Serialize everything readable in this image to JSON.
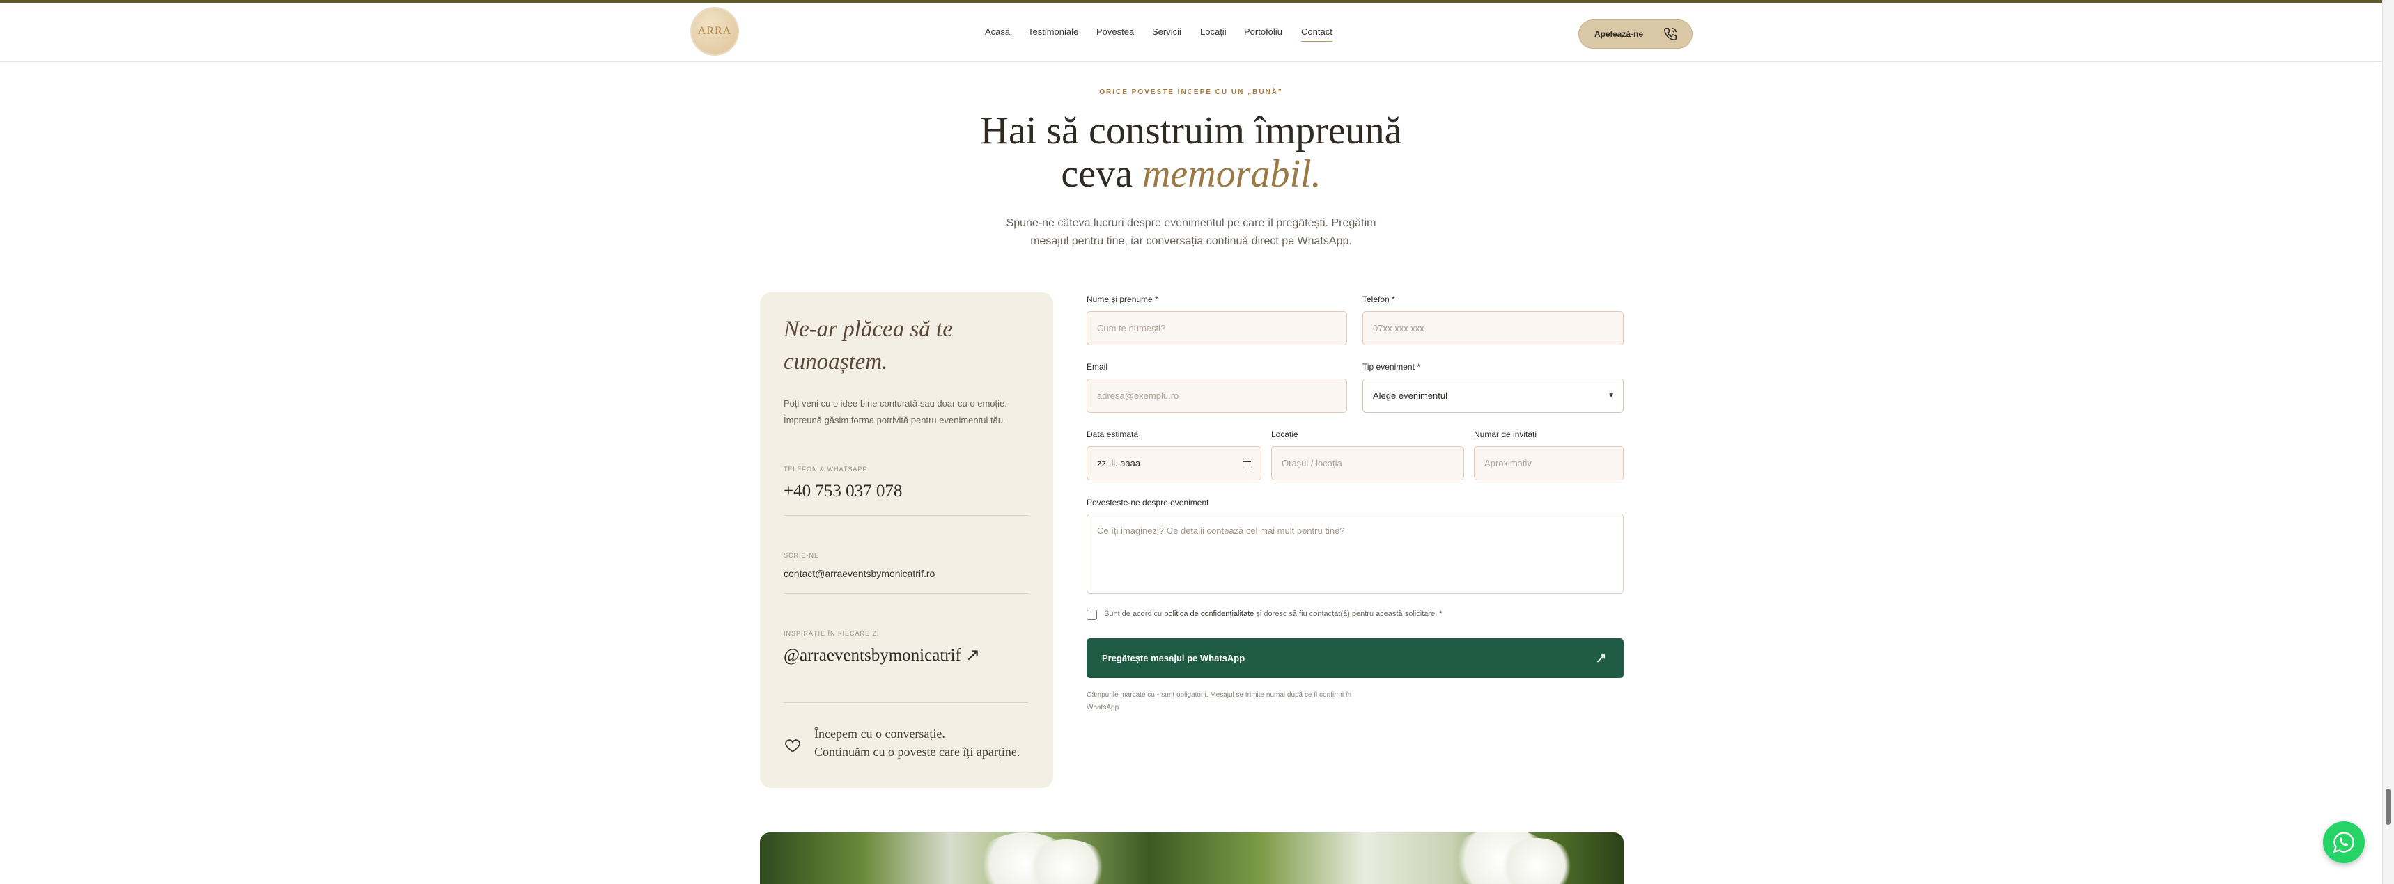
{
  "nav": {
    "logo_text": "ARRA",
    "items": [
      "Acasă",
      "Testimoniale",
      "Povestea",
      "Servicii",
      "Locații",
      "Portofoliu",
      "Contact"
    ],
    "active": "Contact",
    "call_label": "Apelează-ne"
  },
  "hero": {
    "eyebrow": "ORICE POVESTE ÎNCEPE CU UN „BUNĂ\"",
    "title_line1": "Hai să construim împreună",
    "title_line2a": "ceva ",
    "title_line2b": "memorabil.",
    "lead_line1": "Spune-ne câteva lucruri despre evenimentul pe care îl pregătești. Pregătim",
    "lead_line2": "mesajul pentru tine, iar conversația continuă direct pe WhatsApp."
  },
  "card": {
    "script_title": "Ne-ar plăcea să te cunoaștem.",
    "paragraph": "Poți veni cu o idee bine conturată sau doar cu o emoție. Împreună găsim forma potrivită pentru evenimentul tău.",
    "phone_label": "TELEFON & WHATSAPP",
    "phone": "+40 753 037 078",
    "email_label": "SCRIE-NE",
    "email": "contact@arraeventsbymonicatrif.ro",
    "insta_label": "INSPIRAȚIE ÎN FIECARE ZI",
    "insta": "@arraeventsbymonicatrif ↗",
    "quote_line1": "Începem cu o conversație.",
    "quote_line2": "Continuăm cu o poveste care îți aparține."
  },
  "form": {
    "name_label": "Nume și prenume *",
    "name_placeholder": "Cum te numești?",
    "phone_label": "Telefon *",
    "phone_placeholder": "07xx xxx xxx",
    "email_label": "Email",
    "email_placeholder": "adresa@exemplu.ro",
    "type_label": "Tip eveniment *",
    "type_value": "Alege evenimentul",
    "date_label": "Data estimată",
    "date_placeholder": "zz. ll. aaaa",
    "location_label": "Locație",
    "location_placeholder": "Orașul / locația",
    "guests_label": "Număr de invitați",
    "guests_placeholder": "Aproximativ",
    "story_label": "Povestește-ne despre eveniment",
    "story_placeholder": "Ce îți imaginezi? Ce detalii contează cel mai mult pentru tine?",
    "consent_prefix": "Sunt de acord cu ",
    "consent_link": "politica de confidențialitate",
    "consent_suffix": " și doresc să fiu contactat(ă) pentru această solicitare. *",
    "submit_label": "Pregătește mesajul pe WhatsApp",
    "submit_icon": "↗",
    "note": "Câmpurile marcate cu * sunt obligatorii. Mesajul se trimite numai după ce îl confirmi în WhatsApp."
  },
  "icons": {
    "phone": "phone-icon",
    "heart": "heart-icon",
    "whatsapp": "whatsapp-icon",
    "calendar": "calendar-icon",
    "chevron": "chevron-down-icon"
  },
  "colors": {
    "accent_gold": "#9c7a45",
    "button_green": "#1f5b45",
    "card_bg": "#f4efe5",
    "whatsapp": "#25d366"
  }
}
